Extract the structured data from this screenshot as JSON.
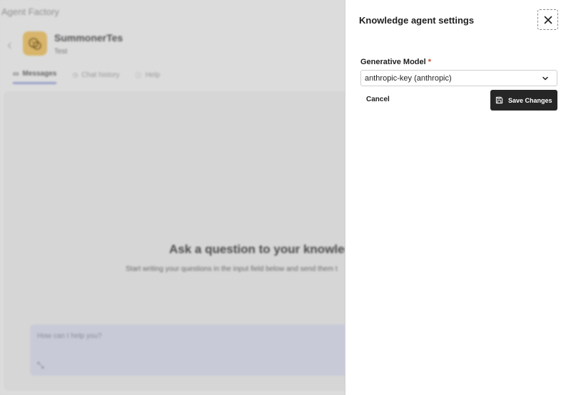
{
  "background": {
    "app_title": "Agent Factory",
    "agent": {
      "name": "SummonerTes",
      "description": "Test"
    },
    "tabs": [
      {
        "label": "Messages",
        "icon": "message-icon",
        "active": true
      },
      {
        "label": "Chat history",
        "icon": "history-icon",
        "active": false
      },
      {
        "label": "Help",
        "icon": "help-icon",
        "active": false
      }
    ],
    "chat": {
      "heading": "Ask a question to your knowled",
      "subheading": "Start writing your questions in the input field below and send them t",
      "input_placeholder": "How can I help you?"
    }
  },
  "panel": {
    "title": "Knowledge agent settings",
    "close_icon": "close-icon",
    "model_field": {
      "label": "Generative Model",
      "required_marker": "*",
      "value": "anthropic-key (anthropic)"
    },
    "cancel_label": "Cancel",
    "save_label": "Save Changes",
    "save_icon": "save-icon",
    "accent": "#262626"
  }
}
